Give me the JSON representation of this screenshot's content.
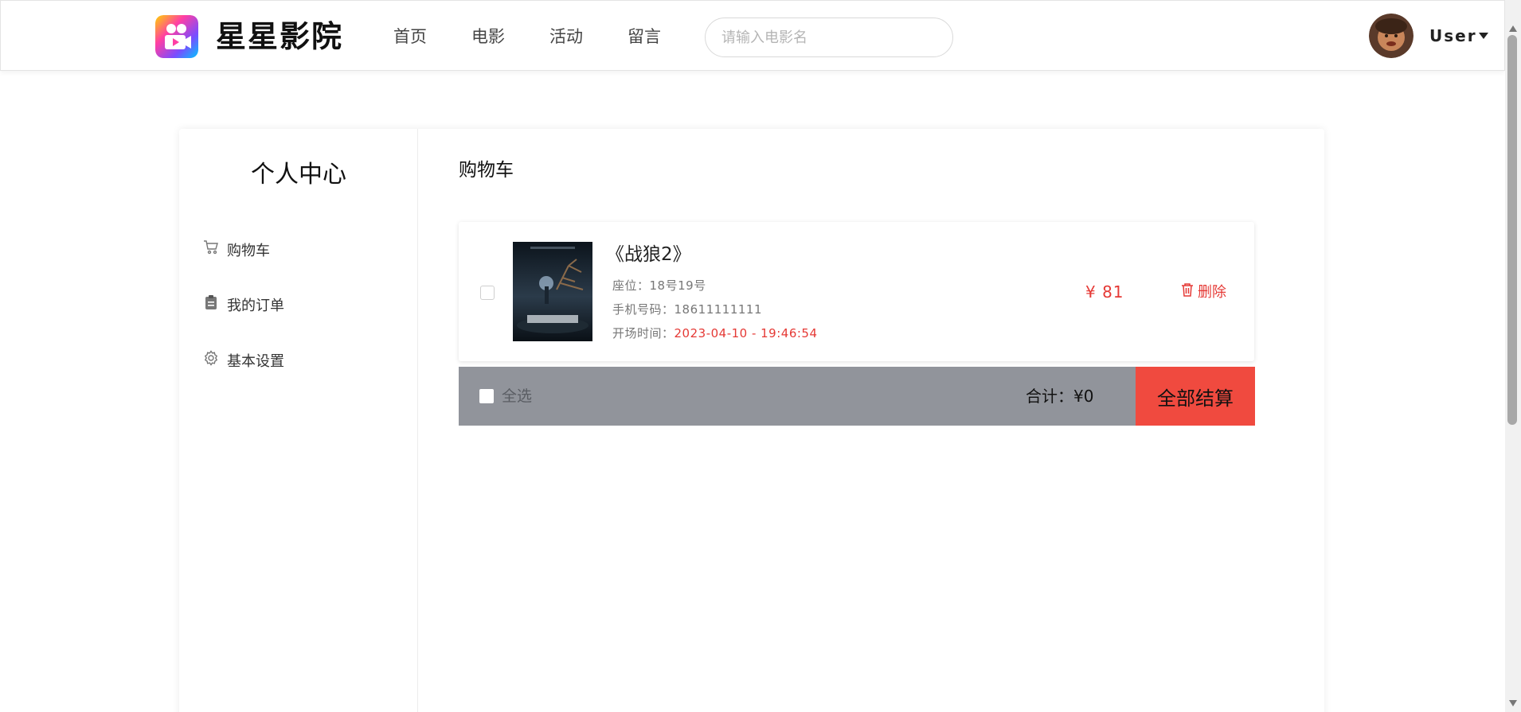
{
  "header": {
    "site_title": "星星影院",
    "nav": [
      "首页",
      "电影",
      "活动",
      "留言"
    ],
    "search_placeholder": "请输入电影名",
    "user_name": "User"
  },
  "sidebar": {
    "title": "个人中心",
    "items": [
      {
        "label": "购物车",
        "icon": "cart-icon"
      },
      {
        "label": "我的订单",
        "icon": "clipboard-icon"
      },
      {
        "label": "基本设置",
        "icon": "gear-icon"
      }
    ]
  },
  "cart": {
    "title": "购物车",
    "items": [
      {
        "movie_title": "《战狼2》",
        "seat_label": "座位：",
        "seat": "18号19号",
        "phone_label": "手机号码：",
        "phone": "18611111111",
        "time_label": "开场时间：",
        "time": "2023-04-10 - 19:46:54",
        "price": "¥ 81",
        "delete_label": "删除",
        "checked": false
      }
    ],
    "select_all_label": "全选",
    "total_label": "合计：",
    "total_value": "¥0",
    "checkout_label": "全部结算"
  },
  "colors": {
    "accent_red": "#e53935",
    "checkout_bg": "#f04a3f",
    "footer_bg": "#91949b"
  }
}
